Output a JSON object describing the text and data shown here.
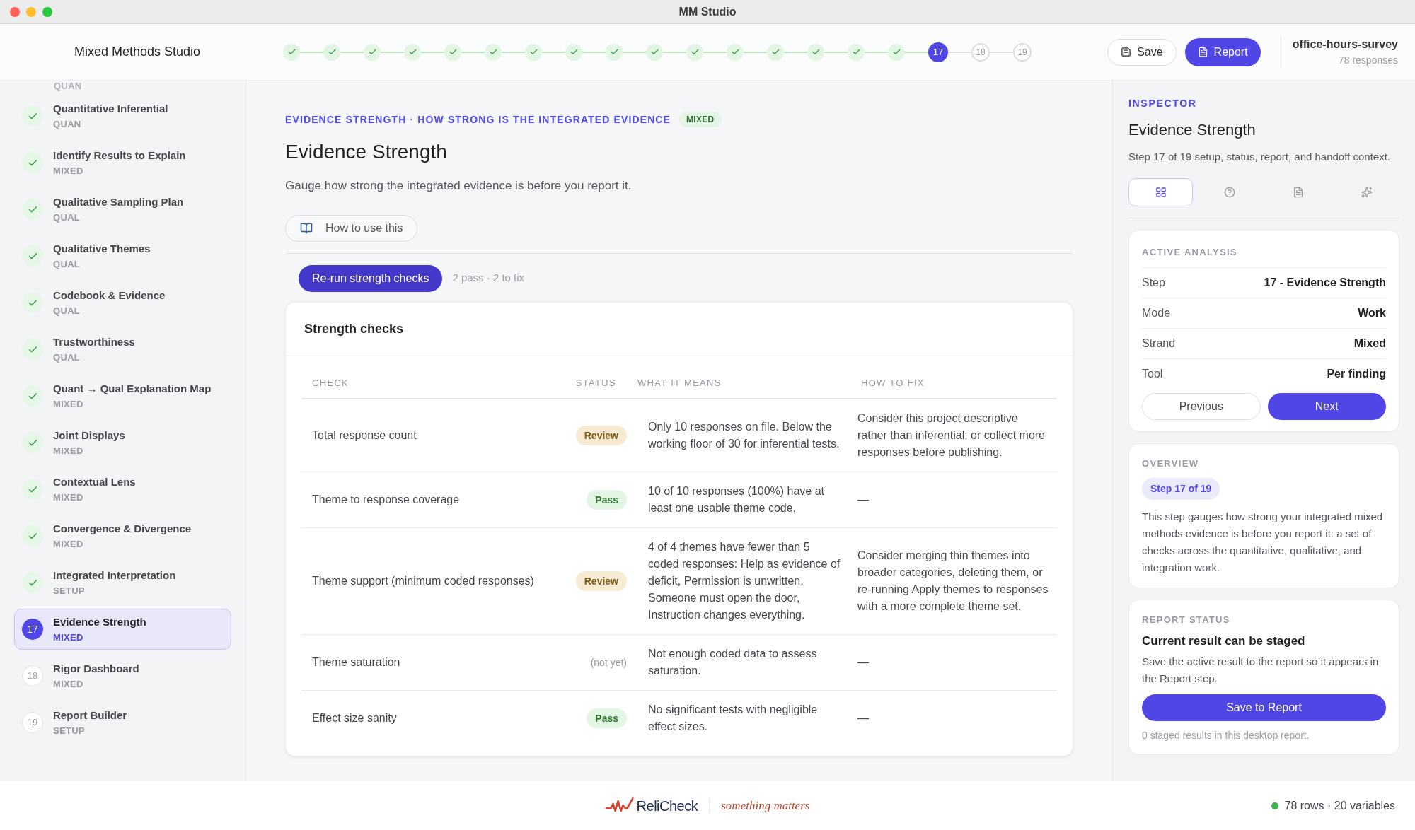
{
  "window": {
    "title": "MM Studio"
  },
  "header": {
    "app_name": "Mixed Methods Studio",
    "save": "Save",
    "report": "Report",
    "project": "office-hours-survey",
    "responses": "78 responses"
  },
  "steps": [
    {
      "done": true,
      "selected": false
    },
    {
      "done": true,
      "selected": false
    },
    {
      "done": true,
      "selected": false
    },
    {
      "done": true,
      "selected": false
    },
    {
      "done": true,
      "selected": false
    },
    {
      "done": true,
      "selected": false
    },
    {
      "done": true,
      "selected": false
    },
    {
      "done": true,
      "selected": false
    },
    {
      "done": true,
      "selected": false
    },
    {
      "done": true,
      "selected": false
    },
    {
      "done": true,
      "selected": false
    },
    {
      "done": true,
      "selected": false
    },
    {
      "done": true,
      "selected": false
    },
    {
      "done": true,
      "selected": false
    },
    {
      "done": true,
      "selected": false
    },
    {
      "done": true,
      "selected": false
    },
    {
      "label": "17",
      "done": false,
      "selected": true
    },
    {
      "label": "18",
      "done": false,
      "selected": false
    },
    {
      "label": "19",
      "done": false,
      "selected": false
    }
  ],
  "sidebar": {
    "items": [
      {
        "kind": "partial",
        "strand": "QUAN"
      },
      {
        "title": "Quantitative Inferential",
        "strand": "QUAN",
        "done": true,
        "selected": false
      },
      {
        "title": "Identify Results to Explain",
        "strand": "MIXED",
        "done": true,
        "selected": false
      },
      {
        "title": "Qualitative Sampling Plan",
        "strand": "QUAL",
        "done": true,
        "selected": false
      },
      {
        "title": "Qualitative Themes",
        "strand": "QUAL",
        "done": true,
        "selected": false
      },
      {
        "title": "Codebook & Evidence",
        "strand": "QUAL",
        "done": true,
        "selected": false
      },
      {
        "title": "Trustworthiness",
        "strand": "QUAL",
        "done": true,
        "selected": false
      },
      {
        "title": "Quant → Qual Explanation Map",
        "strand": "MIXED",
        "done": true,
        "selected": false
      },
      {
        "title": "Joint Displays",
        "strand": "MIXED",
        "done": true,
        "selected": false
      },
      {
        "title": "Contextual Lens",
        "strand": "MIXED",
        "done": true,
        "selected": false
      },
      {
        "title": "Convergence & Divergence",
        "strand": "MIXED",
        "done": true,
        "selected": false
      },
      {
        "title": "Integrated Interpretation",
        "strand": "SETUP",
        "done": true,
        "selected": false
      },
      {
        "title": "Evidence Strength",
        "strand": "MIXED",
        "done": false,
        "number": "17",
        "selected": true
      },
      {
        "title": "Rigor Dashboard",
        "strand": "MIXED",
        "done": false,
        "number": "18",
        "selected": false
      },
      {
        "title": "Report Builder",
        "strand": "SETUP",
        "done": false,
        "number": "19",
        "selected": false
      }
    ]
  },
  "main": {
    "eyebrow": "EVIDENCE STRENGTH · HOW STRONG IS THE INTEGRATED EVIDENCE",
    "strand_badge": "MIXED",
    "title": "Evidence Strength",
    "description": "Gauge how strong the integrated evidence is before you report it.",
    "how_to": "How to use this",
    "rerun": "Re-run strength checks",
    "summary": "2 pass · 2 to fix"
  },
  "table": {
    "title": "Strength checks",
    "columns": [
      "CHECK",
      "STATUS",
      "WHAT IT MEANS",
      "HOW TO FIX"
    ],
    "rows": [
      {
        "check": "Total response count",
        "status": "Review",
        "kind": "review",
        "meaning": "Only 10 responses on file. Below the working floor of 30 for inferential tests.",
        "fix": "Consider this project descriptive rather than inferential; or collect more responses before publishing."
      },
      {
        "check": "Theme to response coverage",
        "status": "Pass",
        "kind": "pass",
        "meaning": "10 of 10 responses (100%) have at least one usable theme code.",
        "fix": "—"
      },
      {
        "check": "Theme support (minimum coded responses)",
        "status": "Review",
        "kind": "review",
        "meaning": "4 of 4 themes have fewer than 5 coded responses: Help as evidence of deficit, Permission is unwritten, Someone must open the door, Instruction changes everything.",
        "fix": "Consider merging thin themes into broader categories, deleting them, or re-running Apply themes to responses with a more complete theme set."
      },
      {
        "check": "Theme saturation",
        "status": "(not yet)",
        "kind": "none",
        "meaning": "Not enough coded data to assess saturation.",
        "fix": "—"
      },
      {
        "check": "Effect size sanity",
        "status": "Pass",
        "kind": "pass",
        "meaning": "No significant tests with negligible effect sizes.",
        "fix": "—"
      }
    ]
  },
  "inspector": {
    "eyebrow": "INSPECTOR",
    "title": "Evidence Strength",
    "subtitle": "Step 17 of 19 setup, status, report, and handoff context.",
    "tabs": [
      {
        "kind": "grid",
        "selected": true
      },
      {
        "kind": "help",
        "selected": false
      },
      {
        "kind": "document",
        "selected": false
      },
      {
        "kind": "sparkle",
        "selected": false
      }
    ],
    "active": {
      "heading": "ACTIVE ANALYSIS",
      "fields": [
        {
          "label": "Step",
          "value": "17 - Evidence Strength"
        },
        {
          "label": "Mode",
          "value": "Work"
        },
        {
          "label": "Strand",
          "value": "Mixed"
        },
        {
          "label": "Tool",
          "value": "Per finding"
        }
      ],
      "previous": "Previous",
      "next": "Next"
    },
    "overview": {
      "heading": "OVERVIEW",
      "badge": "Step 17 of 19",
      "text": "This step gauges how strong your integrated mixed methods evidence is before you report it: a set of checks across the quantitative, qualitative, and integration work."
    },
    "report_status": {
      "heading": "REPORT STATUS",
      "title": "Current result can be staged",
      "text": "Save the active result to the report so it appears in the Report step.",
      "button": "Save to Report",
      "note": "0 staged results in this desktop report."
    }
  },
  "footer": {
    "brand": "ReliCheck",
    "tagline": "something matters",
    "stats": "78 rows · 20 variables"
  }
}
